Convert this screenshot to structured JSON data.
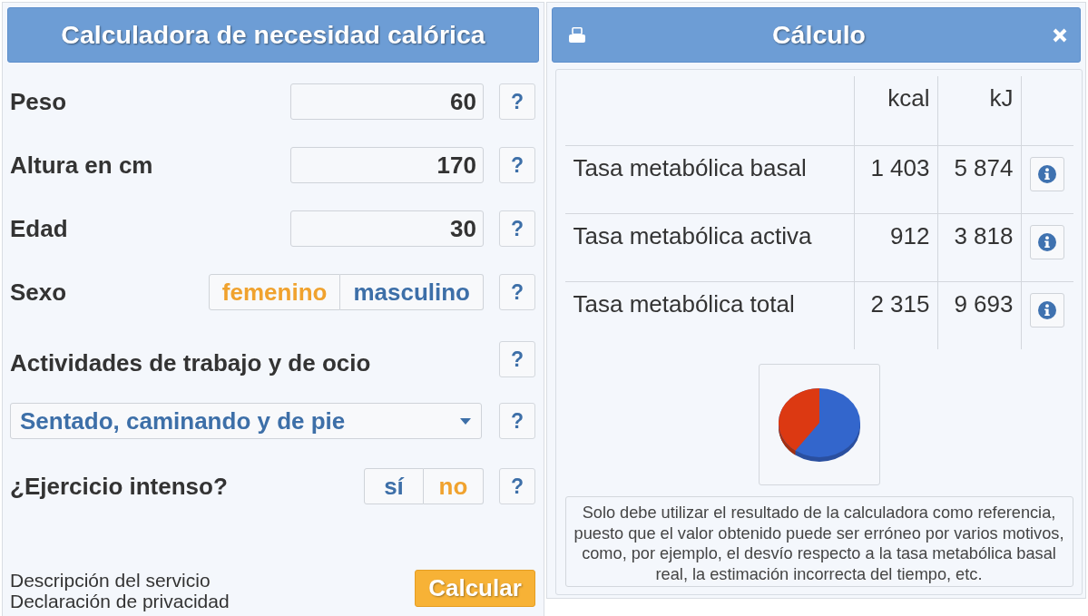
{
  "calculator": {
    "title": "Calculadora de necesidad calórica",
    "fields": [
      {
        "kind": "number",
        "label": "Peso",
        "value": "60",
        "help": "?"
      },
      {
        "kind": "number",
        "label": "Altura en cm",
        "value": "170",
        "help": "?"
      },
      {
        "kind": "number",
        "label": "Edad",
        "value": "30",
        "help": "?"
      },
      {
        "kind": "choice",
        "label": "Sexo",
        "options": [
          {
            "label": "femenino",
            "selected": true
          },
          {
            "label": "masculino",
            "selected": false
          }
        ],
        "help": "?"
      },
      {
        "kind": "heading",
        "label": "Actividades de trabajo y de ocio",
        "help": "?"
      },
      {
        "kind": "select",
        "value": "Sentado, caminando y de pie",
        "help": "?"
      },
      {
        "kind": "choice",
        "label": "¿Ejercicio intenso?",
        "options": [
          {
            "label": "sí",
            "selected": false
          },
          {
            "label": "no",
            "selected": true
          }
        ],
        "help": "?"
      }
    ],
    "links": [
      "Descripción del servicio",
      "Declaración de privacidad"
    ],
    "submit": "Calcular"
  },
  "result": {
    "title": "Cálculo",
    "table": {
      "columns": [
        "kcal",
        "kJ"
      ],
      "rows": [
        {
          "label": "Tasa metabólica basal",
          "kcal": "1 403",
          "kj": "5 874"
        },
        {
          "label": "Tasa metabólica activa",
          "kcal": "912",
          "kj": "3 818"
        },
        {
          "label": "Tasa metabólica total",
          "kcal": "2 315",
          "kj": "9 693"
        }
      ]
    },
    "note": "Solo debe utilizar el resultado de la calculadora como referencia, puesto que el valor obtenido puede ser erróneo por varios motivos, como, por ejemplo, el desvío respecto a la tasa metabólica basal real, la estimación incorrecta del tiempo, etc."
  }
}
